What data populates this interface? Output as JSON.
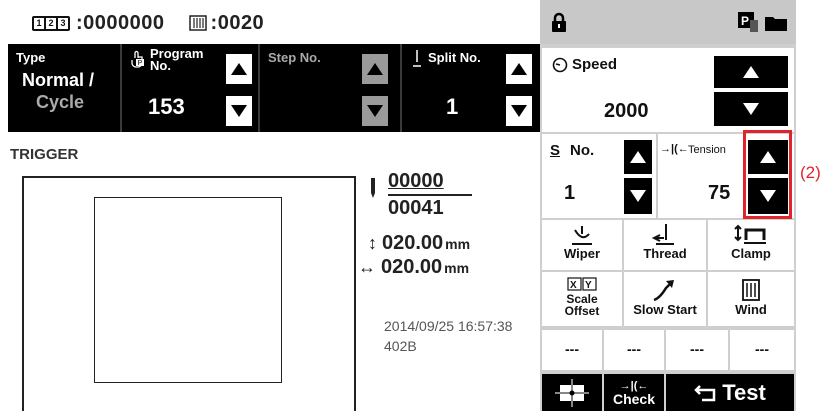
{
  "counters": {
    "count_value": ":0000000",
    "bobbin_value": ":0020"
  },
  "header": {
    "type_title": "Type",
    "type_line1": "Normal /",
    "type_line2": "Cycle",
    "program_title": "Program No.",
    "program_value": "153",
    "step_title": "Step No.",
    "split_title": "Split No.",
    "split_value": "1"
  },
  "trigger_label": "TRIGGER",
  "stitch": {
    "current": "00000",
    "total": "00041"
  },
  "size": {
    "height": "020.00",
    "width": "020.00",
    "unit": "mm"
  },
  "timestamp": "2014/09/25 16:57:38",
  "code": "402B",
  "speed": {
    "label": "Speed",
    "value": "2000"
  },
  "s_no": {
    "label": "No.",
    "value": "1"
  },
  "tension": {
    "label": "Tension",
    "value": "75"
  },
  "functions": {
    "wiper": "Wiper",
    "thread": "Thread",
    "clamp": "Clamp",
    "scale_line1": "Scale",
    "scale_line2": "Offset",
    "slow_start": "Slow Start",
    "wind": "Wind"
  },
  "dash_cells": [
    "---",
    "---",
    "---",
    "---"
  ],
  "bottom": {
    "check": "Check",
    "test": "Test"
  },
  "annotation": "(2)",
  "colors": {
    "highlight": "#e0242b",
    "bar": "#000000"
  }
}
